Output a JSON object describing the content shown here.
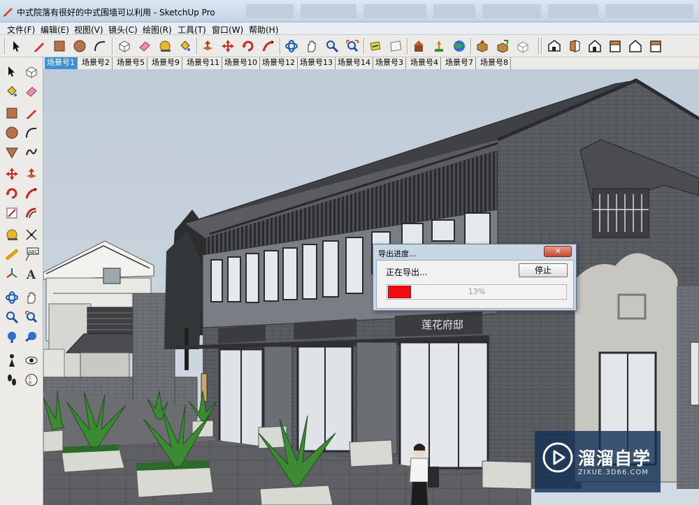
{
  "window": {
    "title": "中式院落有很好的中式围墙可以利用 - SketchUp Pro"
  },
  "menu": [
    {
      "label": "文件(F)"
    },
    {
      "label": "编辑(E)"
    },
    {
      "label": "视图(V)"
    },
    {
      "label": "镜头(C)"
    },
    {
      "label": "绘图(R)"
    },
    {
      "label": "工具(T)"
    },
    {
      "label": "窗口(W)"
    },
    {
      "label": "帮助(H)"
    }
  ],
  "toolbar": {
    "icons": [
      "select-icon",
      "pencil-icon",
      "rectangle-icon",
      "circle-icon",
      "arc-icon",
      "make-component-icon",
      "eraser-icon",
      "tape-measure-icon",
      "paint-bucket-icon",
      "push-pull-icon",
      "move-icon",
      "rotate-icon",
      "follow-me-icon",
      "orbit-icon",
      "pan-icon",
      "zoom-icon",
      "zoom-extents-icon",
      "previous-view-icon",
      "next-view-icon",
      "warehouse-icon",
      "component-add-icon",
      "google-earth-icon",
      "get-models-icon",
      "share-model-icon",
      "extension-icon",
      "iso-view-icon",
      "front-view-icon",
      "top-view-icon",
      "right-view-icon",
      "back-view-icon",
      "left-view-icon"
    ]
  },
  "scenes": [
    {
      "label": "场景号1",
      "active": true
    },
    {
      "label": "场景号2"
    },
    {
      "label": "场景号5"
    },
    {
      "label": "场景号9"
    },
    {
      "label": "场景号11"
    },
    {
      "label": "场景号10"
    },
    {
      "label": "场景号12"
    },
    {
      "label": "场景号13"
    },
    {
      "label": "场景号14"
    },
    {
      "label": "场景号3"
    },
    {
      "label": "场景号4"
    },
    {
      "label": "场景号7"
    },
    {
      "label": "场景号8"
    }
  ],
  "left_toolbar": {
    "icons": [
      "select-icon",
      "make-component-icon",
      "paint-bucket-icon",
      "eraser-icon",
      "rectangle-icon",
      "pencil-icon",
      "circle-icon",
      "arc-icon",
      "polygon-icon",
      "freehand-icon",
      "move-icon",
      "push-pull-icon",
      "rotate-icon",
      "follow-me-icon",
      "scale-icon",
      "offset-icon",
      "tape-measure-icon",
      "dimension-icon",
      "protractor-icon",
      "text-icon",
      "axes-icon",
      "3d-text-icon",
      "orbit-icon",
      "pan-icon",
      "zoom-icon",
      "zoom-window-icon",
      "zoom-extents-icon",
      "previous-view-icon",
      "walk-icon",
      "look-around-icon",
      "footprint-icon",
      "section-plane-icon"
    ]
  },
  "signs": [
    {
      "text": "莲花府邸"
    }
  ],
  "dialog": {
    "title": "导出进度...",
    "close_label": "✕",
    "message": "正在导出...",
    "stop_label": "停止",
    "progress_fraction": 0.13,
    "progress_text": "13%"
  },
  "watermark": {
    "name": "溜溜自学",
    "url": "ZIXUE.3D66.COM"
  },
  "colors": {
    "progress": "#ee0b12",
    "active_tab": "#3d8fd6",
    "sky": "#c9d3dd"
  }
}
